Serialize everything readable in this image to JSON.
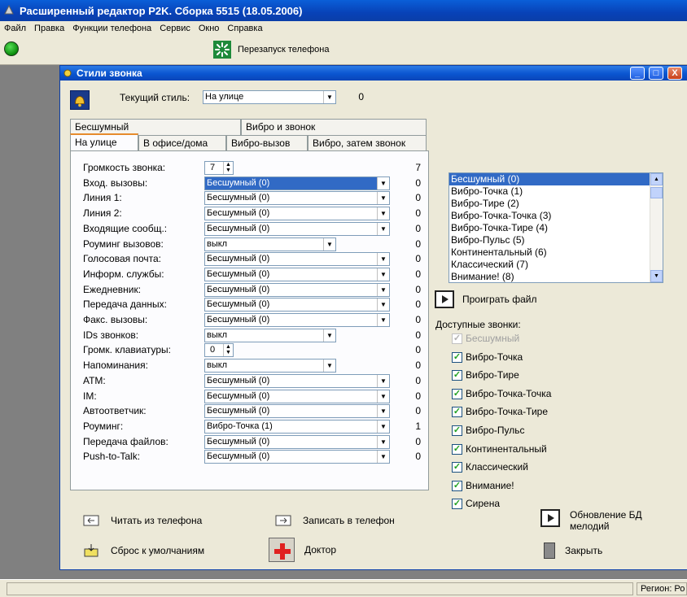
{
  "app": {
    "title": "Расширенный редактор P2K. Сборка 5515 (18.05.2006)",
    "menu": [
      "Файл",
      "Правка",
      "Функции телефона",
      "Сервис",
      "Окно",
      "Справка"
    ],
    "toolbar": {
      "restart_label": "Перезапуск телефона"
    }
  },
  "dialog": {
    "title": "Стили звонка",
    "window_buttons": {
      "minimize": "_",
      "maximize": "□",
      "close": "X"
    },
    "current_style_label": "Текущий стиль:",
    "current_style_value": "На улице",
    "current_style_index": "0",
    "tabs_top": [
      "Бесшумный",
      "Вибро и звонок"
    ],
    "tabs_bottom": [
      "На улице",
      "В офисе/дома",
      "Вибро-вызов",
      "Вибро, затем звонок"
    ],
    "active_tab": "На улице",
    "rows": [
      {
        "label": "Громкость звонка:",
        "kind": "spin",
        "value": "7",
        "count": "7"
      },
      {
        "label": "Вход. вызовы:",
        "kind": "combo",
        "value": "Бесшумный (0)",
        "count": "0",
        "selected": true
      },
      {
        "label": "Линия 1:",
        "kind": "combo",
        "value": "Бесшумный (0)",
        "count": "0"
      },
      {
        "label": "Линия 2:",
        "kind": "combo",
        "value": "Бесшумный (0)",
        "count": "0"
      },
      {
        "label": "Входящие сообщ.:",
        "kind": "combo",
        "value": "Бесшумный (0)",
        "count": "0"
      },
      {
        "label": "Роуминг вызовов:",
        "kind": "short",
        "value": "выкл",
        "count": "0"
      },
      {
        "label": "Голосовая почта:",
        "kind": "combo",
        "value": "Бесшумный (0)",
        "count": "0"
      },
      {
        "label": "Информ. службы:",
        "kind": "combo",
        "value": "Бесшумный (0)",
        "count": "0"
      },
      {
        "label": "Ежедневник:",
        "kind": "combo",
        "value": "Бесшумный (0)",
        "count": "0"
      },
      {
        "label": "Передача данных:",
        "kind": "combo",
        "value": "Бесшумный (0)",
        "count": "0"
      },
      {
        "label": "Факс. вызовы:",
        "kind": "combo",
        "value": "Бесшумный (0)",
        "count": "0"
      },
      {
        "label": "IDs звонков:",
        "kind": "short",
        "value": "выкл",
        "count": "0"
      },
      {
        "label": "Громк. клавиатуры:",
        "kind": "spin",
        "value": "0",
        "count": "0"
      },
      {
        "label": "Напоминания:",
        "kind": "short",
        "value": "выкл",
        "count": "0"
      },
      {
        "label": "АТМ:",
        "kind": "combo",
        "value": "Бесшумный (0)",
        "count": "0"
      },
      {
        "label": "IM:",
        "kind": "combo",
        "value": "Бесшумный (0)",
        "count": "0"
      },
      {
        "label": "Автоответчик:",
        "kind": "combo",
        "value": "Бесшумный (0)",
        "count": "0"
      },
      {
        "label": "Роуминг:",
        "kind": "combo",
        "value": "Вибро-Точка (1)",
        "count": "1"
      },
      {
        "label": "Передача файлов:",
        "kind": "combo",
        "value": "Бесшумный (0)",
        "count": "0"
      },
      {
        "label": "Push-to-Talk:",
        "kind": "combo",
        "value": "Бесшумный (0)",
        "count": "0"
      }
    ],
    "melody_list": [
      "Бесшумный (0)",
      "Вибро-Точка (1)",
      "Вибро-Тире (2)",
      "Вибро-Точка-Точка (3)",
      "Вибро-Точка-Тире (4)",
      "Вибро-Пульс (5)",
      "Континентальный (6)",
      "Классический (7)",
      "Внимание! (8)"
    ],
    "play_file_label": "Проиграть файл",
    "available_label": "Доступные звонки:",
    "available": [
      {
        "label": "Бесшумный",
        "checked": true,
        "disabled": true
      },
      {
        "label": "Вибро-Точка",
        "checked": true
      },
      {
        "label": "Вибро-Тире",
        "checked": true
      },
      {
        "label": "Вибро-Точка-Точка",
        "checked": true
      },
      {
        "label": "Вибро-Точка-Тире",
        "checked": true
      },
      {
        "label": "Вибро-Пульс",
        "checked": true
      },
      {
        "label": "Континентальный",
        "checked": true
      },
      {
        "label": "Классический",
        "checked": true
      },
      {
        "label": "Внимание!",
        "checked": true
      },
      {
        "label": "Сирена",
        "checked": true
      }
    ],
    "buttons": {
      "read": "Читать из телефона",
      "write": "Записать в телефон",
      "update_db_line1": "Обновление БД",
      "update_db_line2": "мелодий",
      "reset": "Сброс к умолчаниям",
      "doctor": "Доктор",
      "close": "Закрыть"
    }
  },
  "statusbar": {
    "region": "Регион: Ро"
  },
  "colors": {
    "title_blue": "#0a55d0",
    "selection": "#316ac5",
    "face": "#ece9d8",
    "workspace": "#808080"
  }
}
